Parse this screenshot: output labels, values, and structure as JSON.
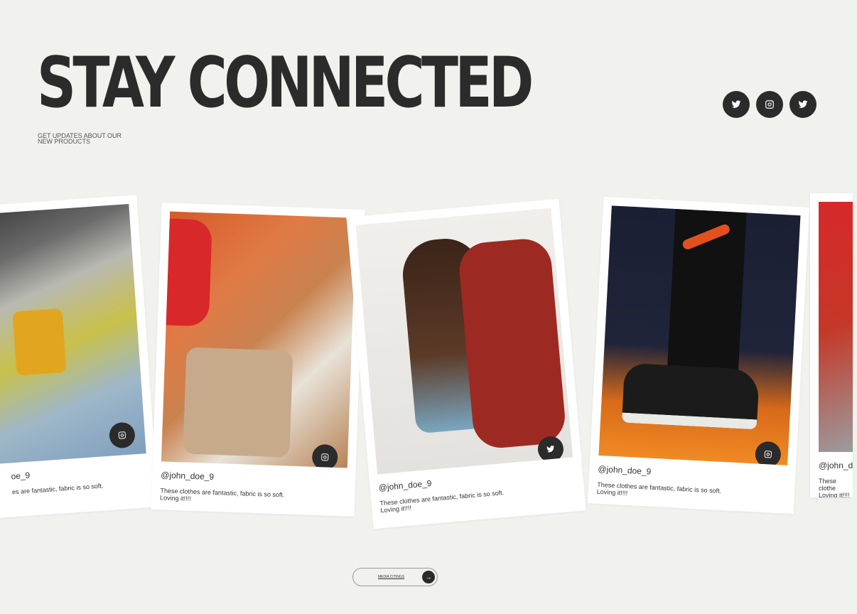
{
  "header": {
    "title": "STAY CONNECTED",
    "subtitle": "GET UPDATES ABOUT OUR NEW PRODUCTS"
  },
  "social": [
    {
      "icon": "twitter-icon"
    },
    {
      "icon": "instagram-icon"
    },
    {
      "icon": "twitter-icon"
    }
  ],
  "posts": [
    {
      "handle": "oe_9",
      "caption": "es are fantastic, fabric is so soft.",
      "icon": "instagram-icon"
    },
    {
      "handle": "@john_doe_9",
      "caption": "These clothes are fantastic, fabric is so soft. Loving it!!!!",
      "icon": "instagram-icon"
    },
    {
      "handle": "@john_doe_9",
      "caption": "These clothes are fantastic, fabric is so soft. Loving it!!!!",
      "icon": "twitter-icon"
    },
    {
      "handle": "@john_doe_9",
      "caption": "These clothes are fantastic, fabric is so soft. Loving it!!!!",
      "icon": "instagram-icon"
    },
    {
      "handle": "@john_dc",
      "caption": "These clothe Loving it!!!!",
      "icon": "instagram-icon"
    }
  ],
  "cta": {
    "label": "MEDIA CITINGS",
    "arrow": "→"
  }
}
